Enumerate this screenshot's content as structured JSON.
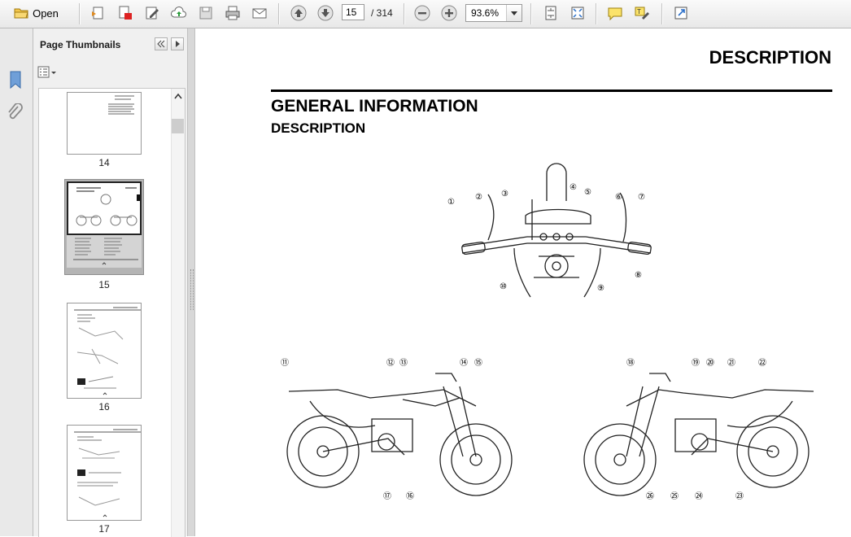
{
  "toolbar": {
    "open_label": "Open",
    "current_page": "15",
    "page_total": "/ 314",
    "zoom": "93.6%",
    "icons": [
      "open-folder-icon",
      "create-pdf-icon",
      "convert-icon",
      "edit-icon",
      "upload-icon",
      "save-icon",
      "print-icon",
      "email-icon",
      "previous-page-icon",
      "next-page-icon",
      "zoom-out-icon",
      "zoom-in-icon",
      "fit-page-icon",
      "full-screen-icon",
      "comment-icon",
      "highlight-icon",
      "expand-icon"
    ]
  },
  "sidebar": {
    "title": "Page Thumbnails",
    "icons": [
      "bookmark-icon",
      "attachment-icon"
    ],
    "thumbnails": [
      {
        "label": "14"
      },
      {
        "label": "15"
      },
      {
        "label": "16"
      },
      {
        "label": "17"
      }
    ]
  },
  "document": {
    "header_title": "DESCRIPTION",
    "heading": "GENERAL INFORMATION",
    "subheading": "DESCRIPTION",
    "callouts_handlebar": [
      "①",
      "②",
      "③",
      "④",
      "⑤",
      "⑥",
      "⑦",
      "⑧",
      "⑨",
      "⑩"
    ],
    "callouts_left": [
      "⑪",
      "⑫",
      "⑬",
      "⑭",
      "⑮",
      "⑯",
      "⑰"
    ],
    "callouts_right": [
      "⑱",
      "⑲",
      "⑳",
      "㉑",
      "㉒",
      "㉓",
      "㉔",
      "㉕",
      "㉖"
    ]
  },
  "colors": {
    "toolbar_bg": "#ececec",
    "panel_bg": "#f0f0f0",
    "selected_thumb": "#b4b4b4",
    "accent_arrow": "#2a6fc9"
  }
}
